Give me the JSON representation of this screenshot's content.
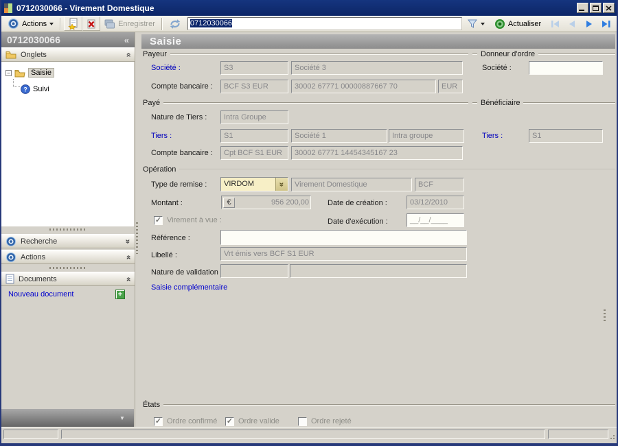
{
  "window": {
    "title": "0712030066 -  Virement Domestique"
  },
  "toolbar": {
    "actions_label": "Actions",
    "save_label": "Enregistrer",
    "document_id": "0712030066",
    "refresh_label": "Actualiser"
  },
  "sidebar": {
    "header_id": "0712030066",
    "onglets_label": "Onglets",
    "tree_root": "Saisie",
    "tree_child": "Suivi",
    "recherche_label": "Recherche",
    "actions_label": "Actions",
    "documents_label": "Documents",
    "new_document_label": "Nouveau document"
  },
  "main": {
    "header": "Saisie",
    "payeur": {
      "group_label": "Payeur",
      "societe_label": "Société :",
      "societe_code": "S3",
      "societe_name": "Société 3",
      "compte_label": "Compte bancaire  :",
      "compte_code": "BCF S3 EUR",
      "compte_number": "30002 67771 00000887667 70",
      "compte_devise": "EUR"
    },
    "donneur": {
      "group_label": "Donneur d'ordre",
      "societe_label": "Société :",
      "societe_value": ""
    },
    "paye": {
      "group_label": "Payé",
      "nature_label": "Nature de Tiers :",
      "nature_value": "Intra Groupe",
      "tiers_label": "Tiers :",
      "tiers_code": "S1",
      "tiers_name": "Société 1",
      "tiers_nature": "Intra groupe",
      "compte_label": "Compte bancaire :",
      "compte_code": "Cpt BCF S1 EUR",
      "compte_number": "30002 67771 14454345167 23"
    },
    "beneficiaire": {
      "group_label": "Bénéficiaire",
      "tiers_label": "Tiers :",
      "tiers_value": "S1"
    },
    "operation": {
      "group_label": "Opération",
      "type_label": "Type de remise :",
      "type_code": "VIRDOM",
      "type_name": "Virement Domestique",
      "type_banque": "BCF",
      "montant_label": "Montant :",
      "montant_devise": "€",
      "montant_value": "956 200,00",
      "date_creation_label": "Date de création :",
      "date_creation_value": "03/12/2010",
      "virement_vue_label": "Virement à vue :",
      "virement_vue_checked": true,
      "date_execution_label": "Date d'exécution :",
      "date_execution_value": "__/__/____",
      "reference_label": "Référence :",
      "reference_value": "",
      "libelle_label": "Libellé :",
      "libelle_value": "Vrt émis vers BCF S1 EUR",
      "nature_validation_label": "Nature de validation :",
      "nature_validation_value1": "",
      "nature_validation_value2": "",
      "saisie_complementaire_link": "Saisie complémentaire"
    },
    "etats": {
      "group_label": "États",
      "checkboxes": [
        {
          "label": "Ordre confirmé",
          "checked": true
        },
        {
          "label": "Ordre valide",
          "checked": true
        },
        {
          "label": "Ordre rejeté",
          "checked": false
        }
      ]
    }
  },
  "glyphs": {
    "collapse_left": "«",
    "double_chevron": "»",
    "dropdown_arrow": "▼",
    "check": "✓",
    "tree_collapse": "−",
    "plus": "+"
  },
  "colors": {
    "titlebar": "#0e2a6d",
    "link_blue": "#0000cd",
    "label_blue": "#0000bd",
    "combo_highlight": "#f7efc6",
    "selection": "#0a246a"
  }
}
